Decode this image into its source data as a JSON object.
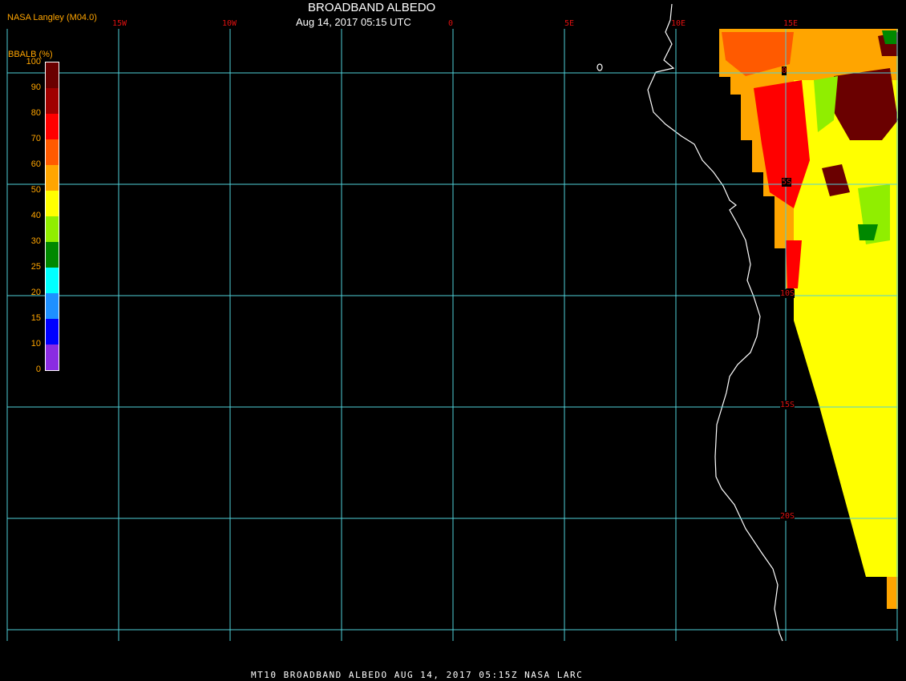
{
  "header": {
    "title": "BROADBAND ALBEDO",
    "datetime": "Aug 14, 2017 05:15 UTC",
    "credit": "NASA Langley (M04.0)"
  },
  "footer": {
    "caption": "MT10  BROADBAND ALBEDO   AUG 14, 2017 05:15Z   NASA LARC"
  },
  "colorbar": {
    "label": "BBALB (%)",
    "ticks": [
      "100",
      "90",
      "80",
      "70",
      "60",
      "50",
      "40",
      "30",
      "25",
      "20",
      "15",
      "10",
      "0"
    ],
    "colors": [
      "#6a0000",
      "#a00000",
      "#ff0000",
      "#ff5a00",
      "#ffa500",
      "#ffff00",
      "#90ee00",
      "#008800",
      "#00ffff",
      "#1e90ff",
      "#0000ff",
      "#8a2be2"
    ]
  },
  "grid": {
    "color": "#4fd1d9",
    "lon_labels": [
      "15W",
      "10W",
      "0",
      "5E",
      "10E",
      "15E"
    ],
    "lat_labels": [
      "0",
      "5S",
      "10S",
      "15S",
      "20S"
    ]
  },
  "map_colors": {
    "coastline": "#ffffff",
    "dark_red": "#6a0000",
    "red": "#ff0000",
    "orange_red": "#ff5a00",
    "orange": "#ffa500",
    "yellow": "#ffff00",
    "light_green": "#90ee00",
    "green": "#008800"
  }
}
